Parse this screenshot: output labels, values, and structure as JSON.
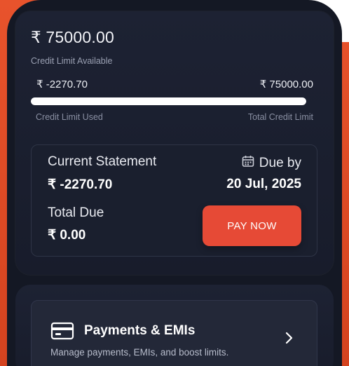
{
  "credit": {
    "available_amount": "₹ 75000.00",
    "available_label": "Credit Limit Available",
    "used_amount": "₹ -2270.70",
    "total_amount": "₹ 75000.00",
    "used_label": "Credit Limit Used",
    "total_label": "Total Credit Limit",
    "progress_fraction": 1.0
  },
  "statement": {
    "title": "Current Statement",
    "amount": "₹ -2270.70",
    "due_label": "Due by",
    "due_icon": "calendar-icon",
    "due_date": "20 Jul, 2025",
    "total_due_title": "Total Due",
    "total_due_amount": "₹ 0.00",
    "pay_button_label": "PAY NOW"
  },
  "payments": {
    "icon": "card-icon",
    "title": "Payments & EMIs",
    "subtitle": "Manage payments, EMIs, and boost limits.",
    "chevron_icon": "chevron-right-icon"
  },
  "colors": {
    "accent": "#e64a36",
    "background": "#141824",
    "card": "#1d2233"
  }
}
